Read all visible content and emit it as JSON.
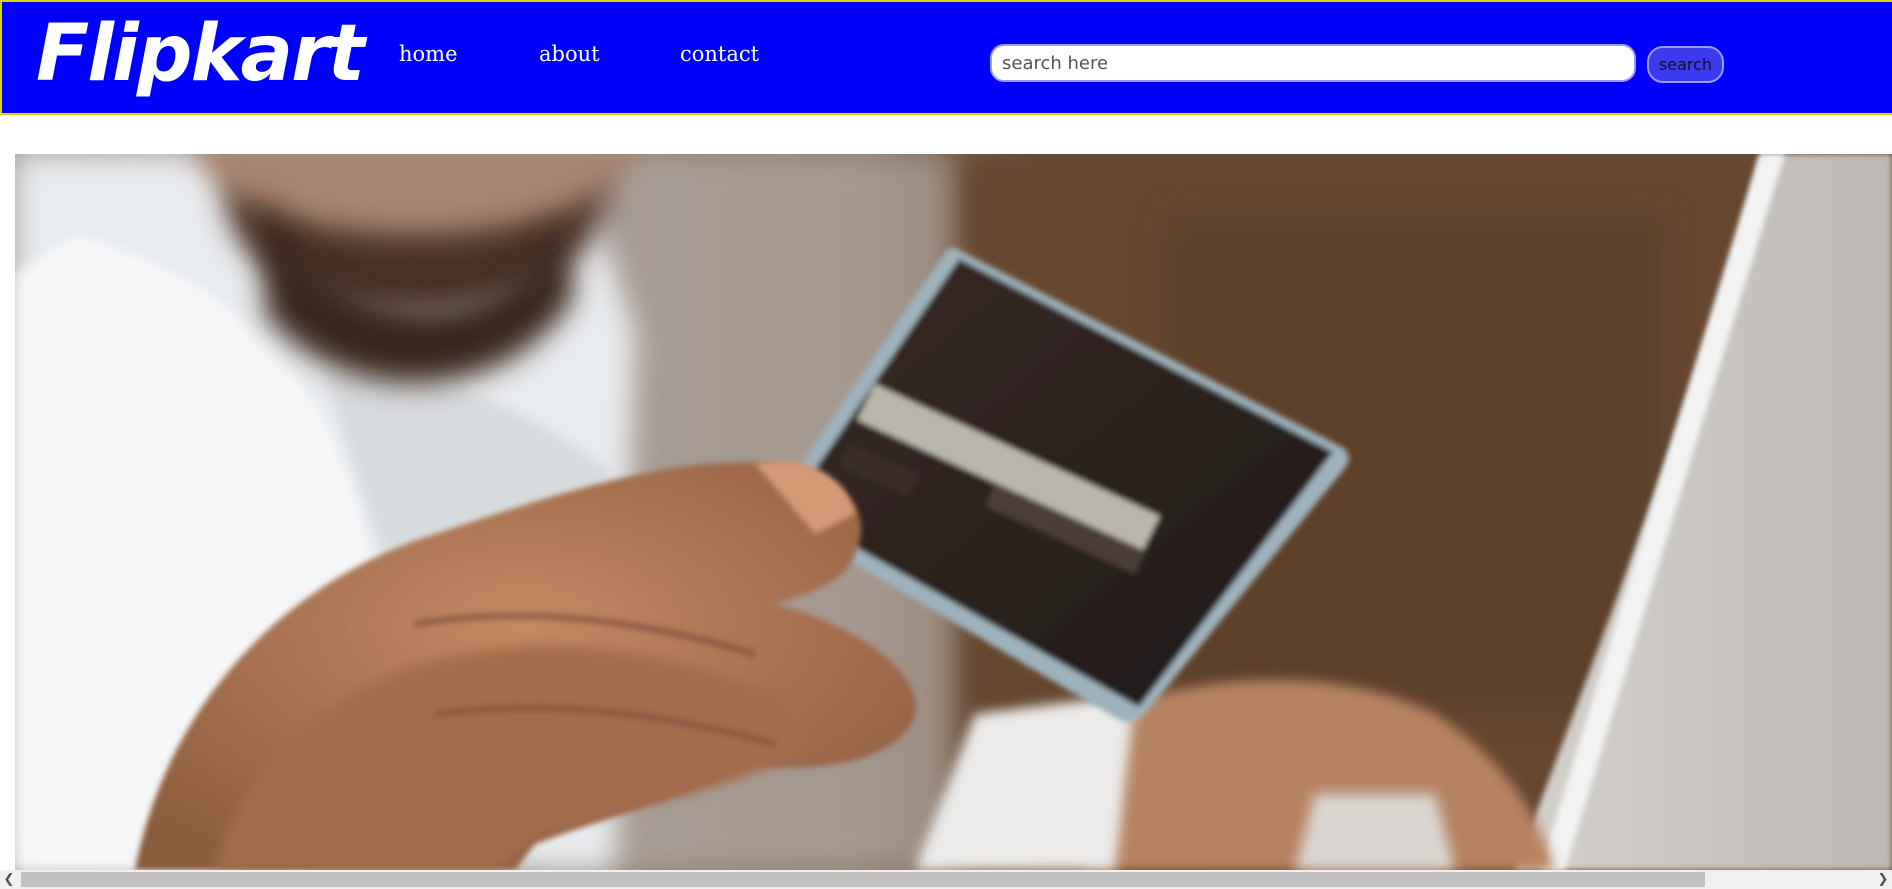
{
  "brand": {
    "logo_text": "Flipkart",
    "nav_color": "#0000ff"
  },
  "nav": {
    "links": [
      {
        "label": "home"
      },
      {
        "label": "about"
      },
      {
        "label": "contact"
      }
    ]
  },
  "search": {
    "placeholder": "search here",
    "value": "",
    "button_label": "search"
  },
  "hero": {
    "image_subject": "person holding a credit card in front of a laptop"
  },
  "scrollbar": {
    "orientation": "horizontal",
    "left_arrow_icon": "chevron-left-icon",
    "right_arrow_icon": "chevron-right-icon",
    "thumb_fraction": 0.91,
    "scroll_position": 0
  }
}
